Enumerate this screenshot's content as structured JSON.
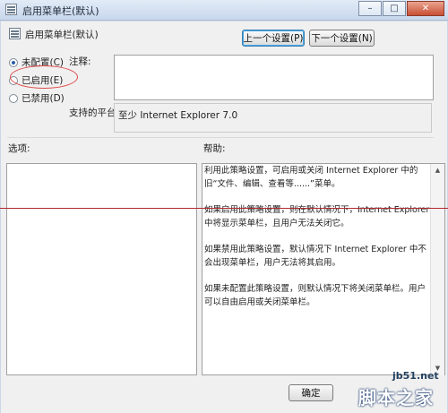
{
  "window": {
    "title": "启用菜单栏(默认)",
    "minimize": "–",
    "maximize": "□",
    "close": "✕"
  },
  "header": {
    "title": "启用菜单栏(默认)",
    "prev_button": "上一个设置(P)",
    "next_button": "下一个设置(N)"
  },
  "state": {
    "options": [
      {
        "label": "未配置(C)",
        "selected": true
      },
      {
        "label": "已启用(E)",
        "selected": false
      },
      {
        "label": "已禁用(D)",
        "selected": false
      }
    ]
  },
  "comment": {
    "label": "注释:",
    "value": ""
  },
  "platform": {
    "label": "支持的平台:",
    "value": "至少 Internet Explorer 7.0"
  },
  "options_pane": {
    "label": "选项:"
  },
  "help": {
    "label": "帮助:",
    "paragraphs": [
      "利用此策略设置，可启用或关闭 Internet Explorer 中的旧“文件、编辑、查看等......”菜单。",
      "如果启用此策略设置，则在默认情况下，Internet Explorer 中将显示菜单栏，且用户无法关闭它。",
      "如果禁用此策略设置，默认情况下 Internet Explorer 中不会出现菜单栏，用户无法将其启用。",
      "如果未配置此策略设置，则默认情况下将关闭菜单栏。用户可以自由启用或关闭菜单栏。"
    ]
  },
  "footer": {
    "ok_button": "确定"
  },
  "watermark": {
    "site": "jb51.net",
    "brand": "脚本之家"
  },
  "colors": {
    "annotation": "#de4b4b",
    "rule_line": "#b2282d"
  }
}
